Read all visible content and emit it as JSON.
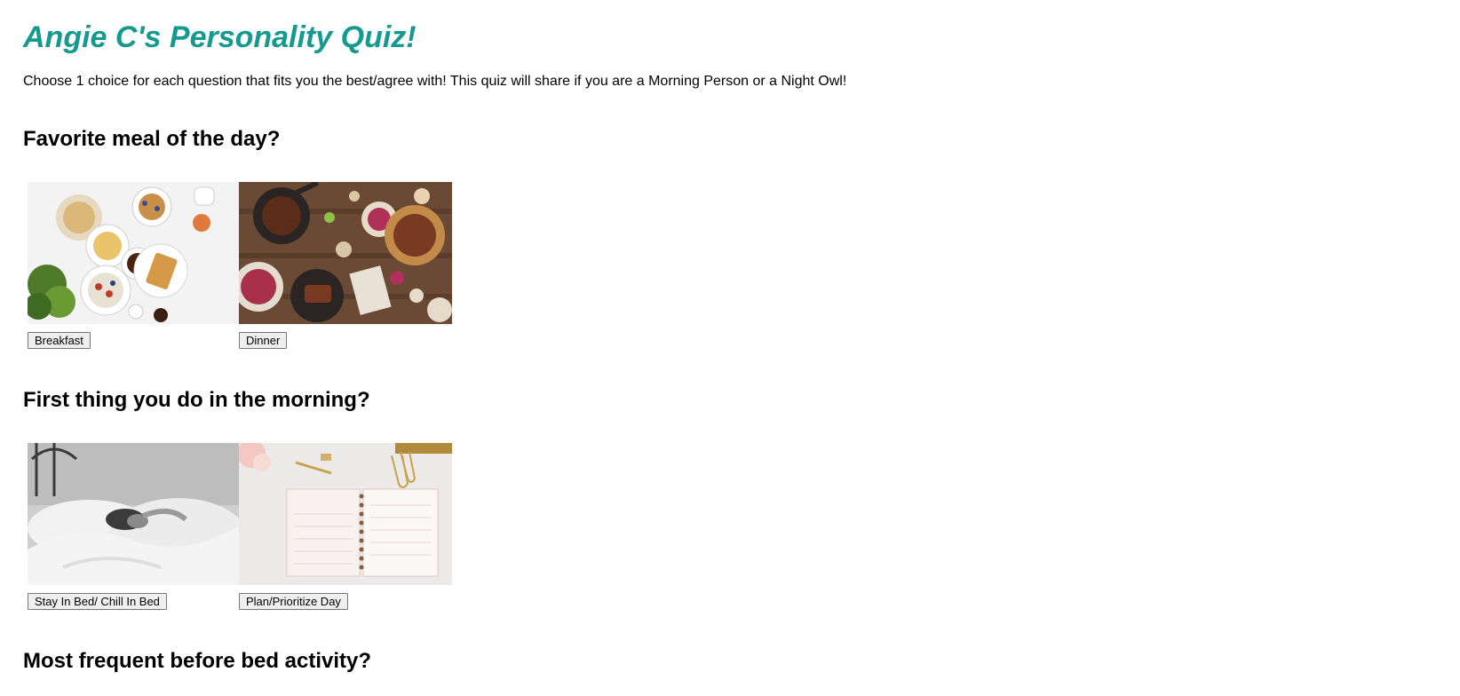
{
  "title": "Angie C's Personality Quiz!",
  "intro": "Choose 1 choice for each question that fits you the best/agree with! This quiz will share if you are a Morning Person or a Night Owl!",
  "questions": [
    {
      "heading": "Favorite meal of the day?",
      "choices": [
        {
          "label": "Breakfast",
          "image": "breakfast-spread"
        },
        {
          "label": "Dinner",
          "image": "dinner-spread"
        }
      ]
    },
    {
      "heading": "First thing you do in the morning?",
      "choices": [
        {
          "label": "Stay In Bed/ Chill In Bed",
          "image": "person-in-bed"
        },
        {
          "label": "Plan/Prioritize Day",
          "image": "planner-notebook"
        }
      ]
    },
    {
      "heading": "Most frequent before bed activity?"
    }
  ]
}
